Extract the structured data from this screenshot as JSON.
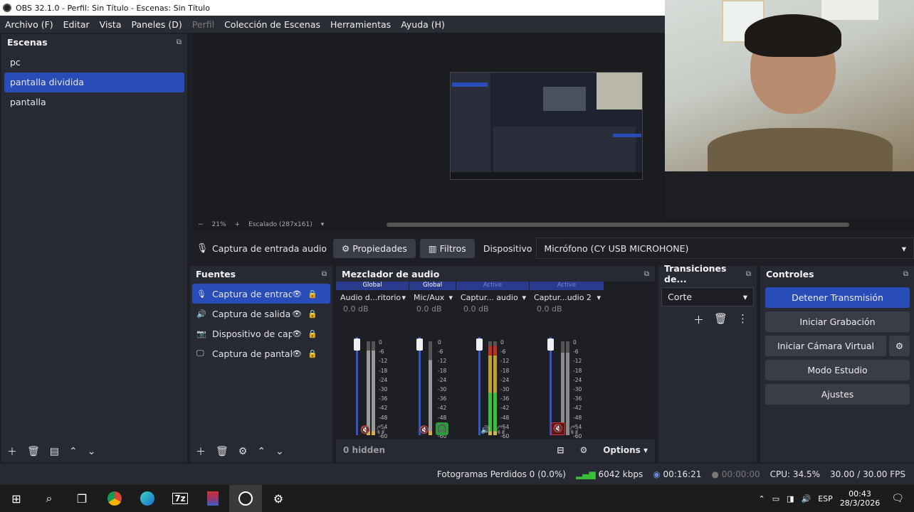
{
  "window": {
    "title": "OBS 32.1.0 - Perfil: Sin Título - Escenas: Sin Título"
  },
  "menu": {
    "items": [
      "Archivo (F)",
      "Editar",
      "Vista",
      "Paneles (D)",
      "Perfil",
      "Colección de Escenas",
      "Herramientas",
      "Ayuda (H)"
    ],
    "disabled_index": 4
  },
  "scenes": {
    "title": "Escenas",
    "items": [
      "pc",
      "pantalla dividida",
      "pantalla"
    ],
    "selected_index": 1
  },
  "preview": {
    "zoom": "21%",
    "scale_label": "Escalado (287x161)"
  },
  "props_bar": {
    "source_name": "Captura de entrada audio",
    "properties_label": "Propiedades",
    "filters_label": "Filtros",
    "device_label": "Dispositivo",
    "device_value": "Micrófono (CY USB MICROHONE)"
  },
  "sources": {
    "title": "Fuentes",
    "items": [
      {
        "label": "Captura de entrada",
        "icon": "mic-icon"
      },
      {
        "label": "Captura de salida de",
        "icon": "speaker-icon"
      },
      {
        "label": "Dispositivo de captu",
        "icon": "camera-icon"
      },
      {
        "label": "Captura de pantalla",
        "icon": "monitor-icon"
      }
    ],
    "selected_index": 0
  },
  "mixer": {
    "title": "Mezclador de audio",
    "channels": [
      {
        "scope": "Global",
        "name": "Audio d...ritorio",
        "db": "0.0 dB"
      },
      {
        "scope": "Global",
        "name": "Mic/Aux",
        "db": "0.0 dB"
      },
      {
        "scope": "Active",
        "name": "Captur... audio",
        "db": "0.0 dB"
      },
      {
        "scope": "Active",
        "name": "Captur...udio 2",
        "db": "0.0 dB"
      }
    ],
    "ticks": [
      "0",
      "-6",
      "-12",
      "-18",
      "-24",
      "-30",
      "-36",
      "-42",
      "-48",
      "-54",
      "-60"
    ],
    "hidden_label": "0 hidden",
    "options_label": "Options"
  },
  "transitions": {
    "title": "Transiciones de...",
    "selected": "Corte"
  },
  "controls": {
    "title": "Controles",
    "buttons": [
      "Detener Transmisión",
      "Iniciar Grabación",
      "Iniciar Cámara Virtual",
      "Modo Estudio",
      "Ajustes"
    ]
  },
  "status": {
    "dropped": "Fotogramas Perdidos 0 (0.0%)",
    "bitrate": "6042 kbps",
    "stream_time": "00:16:21",
    "rec_time": "00:00:00",
    "cpu": "CPU: 34.5%",
    "fps": "30.00 / 30.00 FPS"
  },
  "taskbar": {
    "lang": "ESP",
    "time": "00:43",
    "date": "28/3/2026"
  },
  "colors": {
    "accent": "#284cb8",
    "bg": "#1e1f24",
    "dock": "#272a33"
  }
}
